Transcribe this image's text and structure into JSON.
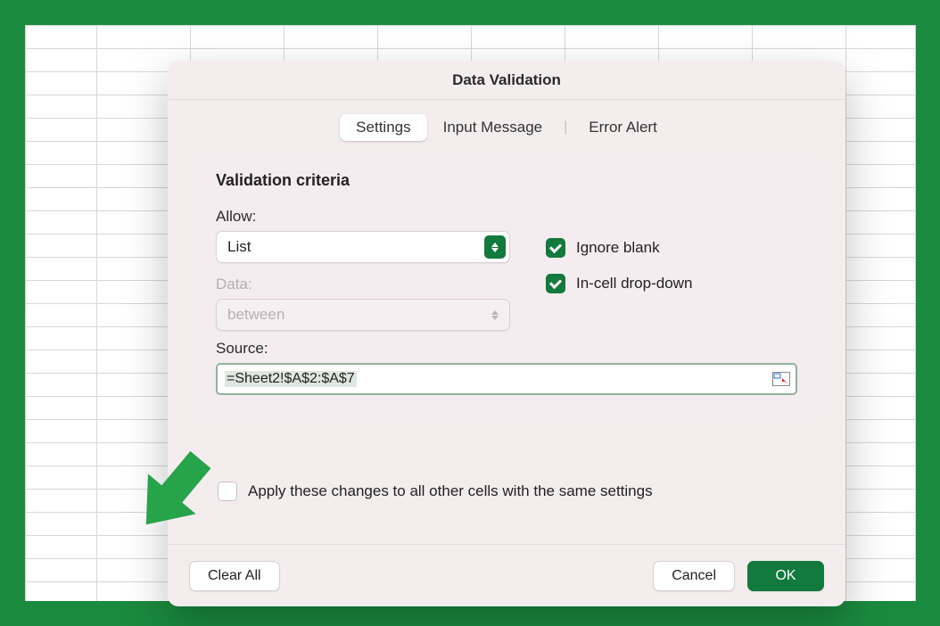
{
  "dialog": {
    "title": "Data Validation",
    "tabs": {
      "settings": "Settings",
      "inputMessage": "Input Message",
      "errorAlert": "Error Alert"
    },
    "sectionLabel": "Validation criteria",
    "allowLabel": "Allow:",
    "allowValue": "List",
    "dataLabel": "Data:",
    "dataValue": "between",
    "sourceLabel": "Source:",
    "sourceValue": "=Sheet2!$A$2:$A$7",
    "ignoreBlankLabel": "Ignore blank",
    "ignoreBlankChecked": true,
    "inCellDropdownLabel": "In-cell drop-down",
    "inCellDropdownChecked": true,
    "applyAllLabel": "Apply these changes to all other cells with the same settings",
    "applyAllChecked": false,
    "clearAll": "Clear All",
    "cancel": "Cancel",
    "ok": "OK"
  }
}
